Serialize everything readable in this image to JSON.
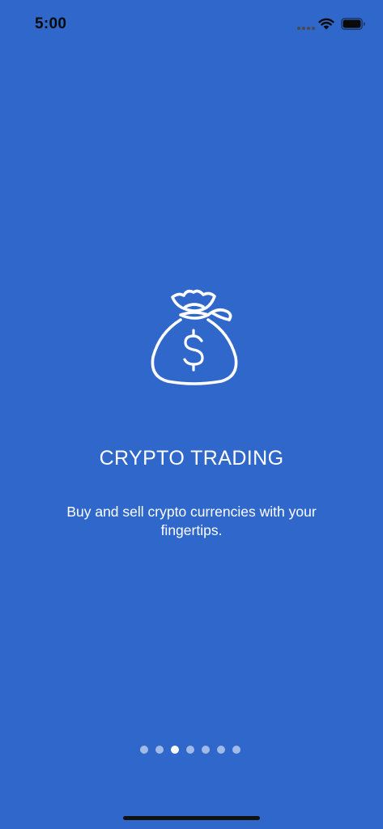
{
  "status_bar": {
    "time": "5:00"
  },
  "onboarding": {
    "icon": "money-bag-icon",
    "title": "CRYPTO TRADING",
    "description": "Buy and sell crypto currencies with your fingertips."
  },
  "pager": {
    "total_pages": 7,
    "current_page": 3
  },
  "colors": {
    "background": "#2f67ca",
    "text": "#ffffff"
  }
}
